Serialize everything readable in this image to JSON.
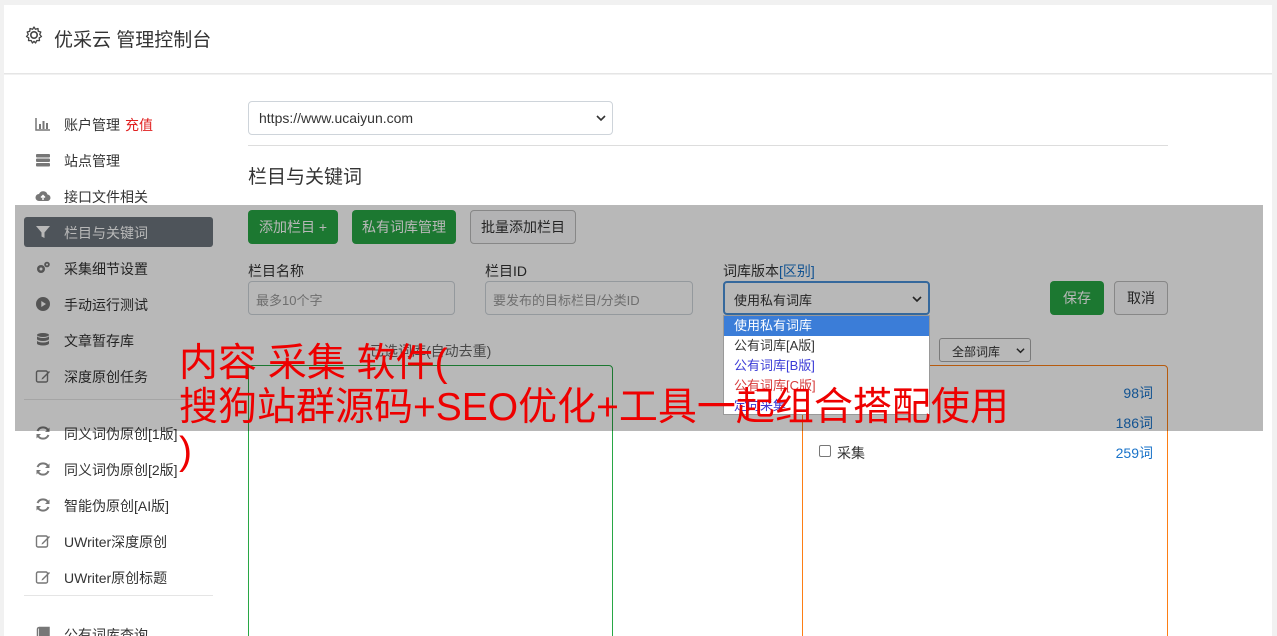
{
  "header": {
    "title": "优采云 管理控制台",
    "icon": "gear-icon"
  },
  "sidebar": {
    "items": [
      {
        "label": "账户管理",
        "badge": "充值",
        "icon": "bar-chart-icon"
      },
      {
        "label": "站点管理",
        "icon": "server-icon"
      },
      {
        "label": "接口文件相关",
        "icon": "cloud-upload-icon"
      },
      {
        "label": "栏目与关键词",
        "icon": "filter-icon",
        "active": true
      },
      {
        "label": "采集细节设置",
        "icon": "gears-icon"
      },
      {
        "label": "手动运行测试",
        "icon": "play-circle-icon"
      },
      {
        "label": "文章暂存库",
        "icon": "database-icon"
      },
      {
        "label": "深度原创任务",
        "icon": "edit-icon"
      },
      {
        "label": "同义词伪原创[1版]",
        "icon": "refresh-icon"
      },
      {
        "label": "同义词伪原创[2版]",
        "icon": "refresh-icon"
      },
      {
        "label": "智能伪原创[AI版]",
        "icon": "refresh-icon"
      },
      {
        "label": "UWriter深度原创",
        "icon": "edit-icon"
      },
      {
        "label": "UWriter原创标题",
        "icon": "edit-icon"
      },
      {
        "label": "公有词库查询",
        "icon": "book-icon"
      }
    ]
  },
  "main": {
    "site_select": {
      "value": "https://www.ucaiyun.com"
    },
    "section_title": "栏目与关键词",
    "buttons": {
      "add_column": "添加栏目 +",
      "private_library": "私有词库管理",
      "batch_add": "批量添加栏目",
      "save": "保存",
      "cancel": "取消"
    },
    "form": {
      "column_name_label": "栏目名称",
      "column_name_placeholder": "最多10个字",
      "column_id_label": "栏目ID",
      "column_id_placeholder": "要发布的目标栏目/分类ID",
      "version_label": "词库版本",
      "version_link": "[区别]",
      "version_value": "使用私有词库",
      "version_options": [
        {
          "label": "使用私有词库",
          "color": "#ffffff"
        },
        {
          "label": "公有词库[A版]",
          "color": "#333333"
        },
        {
          "label": "公有词库[B版]",
          "color": "#3b3bd6"
        },
        {
          "label": "公有词库[C版]",
          "color": "#d63b3b"
        },
        {
          "label": "定向采集",
          "color": "#3b3bd6"
        }
      ]
    },
    "selected_label": "已选词库(自动去重)",
    "all_libs_select": "全部词库",
    "libraries": [
      {
        "name": "",
        "count": "98词"
      },
      {
        "name": "",
        "count": "186词"
      },
      {
        "name": "采集",
        "count": "259词"
      }
    ]
  },
  "watermark": {
    "line1": "内容 采集 软件(",
    "line2": "搜狗站群源码+SEO优化+工具一起组合搭配使用",
    "line3": ")"
  },
  "colors": {
    "accent_green": "#28a745",
    "active_nav": "#6c757d",
    "link_blue": "#1a73c9",
    "recharge_red": "#e02020"
  }
}
